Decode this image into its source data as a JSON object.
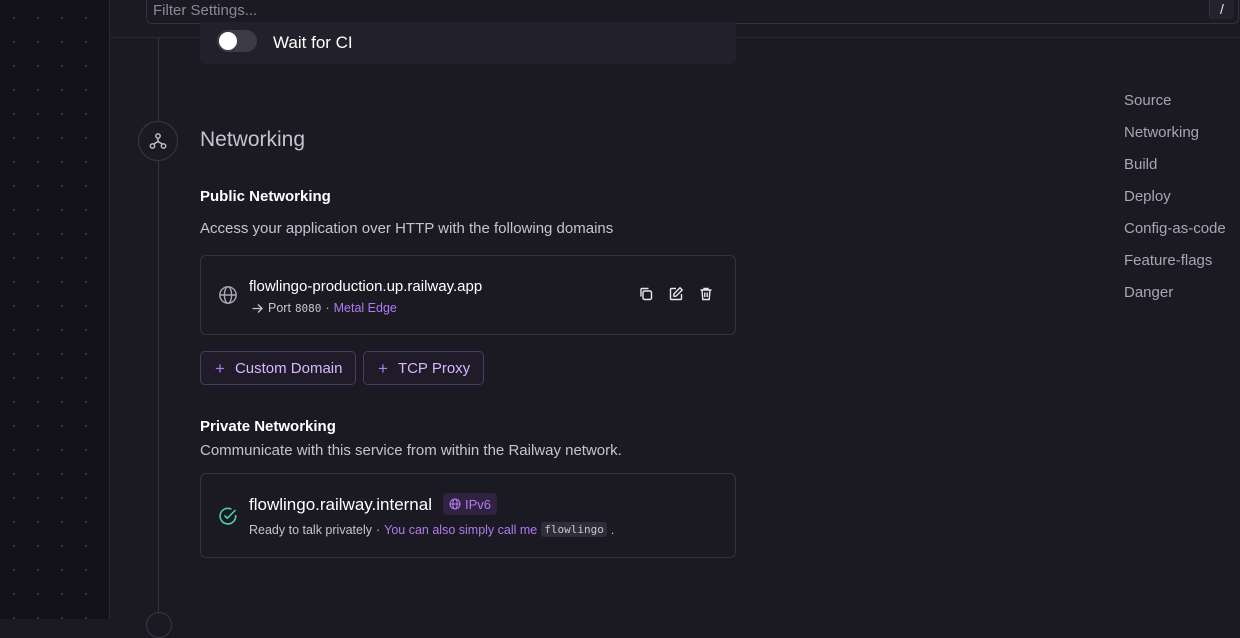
{
  "filter": {
    "placeholder": "Filter Settings...",
    "shortcut": "/"
  },
  "wait_for_ci": {
    "label": "Wait for CI",
    "enabled": false
  },
  "networking": {
    "title": "Networking",
    "public": {
      "heading": "Public Networking",
      "description": "Access your application over HTTP with the following domains",
      "domain": "flowlingo-production.up.railway.app",
      "port_label": "Port",
      "port": "8080",
      "separator": "·",
      "edge": "Metal Edge"
    },
    "buttons": {
      "custom_domain": "Custom Domain",
      "tcp_proxy": "TCP Proxy"
    },
    "private": {
      "heading": "Private Networking",
      "description": "Communicate with this service from within the Railway network.",
      "hostname": "flowlingo.railway.internal",
      "badge": "IPv6",
      "status": "Ready to talk privately",
      "separator": "·",
      "hint": "You can also simply call me",
      "alias": "flowlingo",
      "period": "."
    }
  },
  "toc": [
    "Source",
    "Networking",
    "Build",
    "Deploy",
    "Config-as-code",
    "Feature-flags",
    "Danger"
  ],
  "colors": {
    "accent": "#b179f1",
    "success": "#4fd1a5",
    "background": "#1b1a23"
  }
}
